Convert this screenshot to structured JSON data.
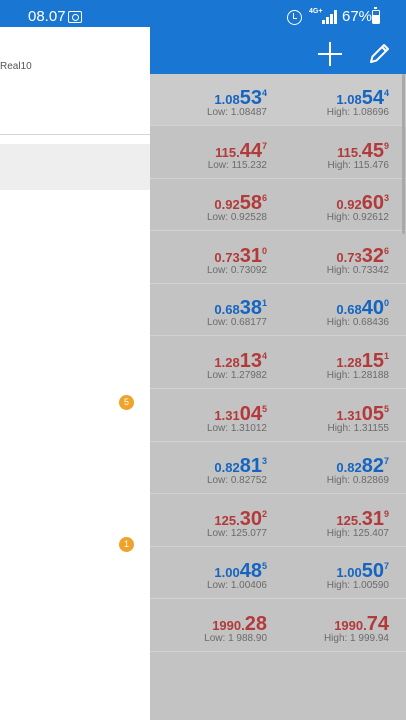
{
  "status_bar": {
    "time": "08.07",
    "network": "4G+",
    "battery_pct": "67%"
  },
  "drawer": {
    "account_label": "Real10",
    "badges": [
      {
        "count": "5"
      },
      {
        "count": "1"
      }
    ]
  },
  "quotes": [
    {
      "bid": {
        "base": "1.08",
        "big": "53",
        "sup": "4"
      },
      "ask": {
        "base": "1.08",
        "big": "54",
        "sup": "4"
      },
      "low": "Low: 1.08487",
      "high": "High: 1.08696",
      "dir": "up"
    },
    {
      "bid": {
        "base": "115.",
        "big": "44",
        "sup": "7"
      },
      "ask": {
        "base": "115.",
        "big": "45",
        "sup": "9"
      },
      "low": "Low: 115.232",
      "high": "High: 115.476",
      "dir": "down"
    },
    {
      "bid": {
        "base": "0.92",
        "big": "58",
        "sup": "6"
      },
      "ask": {
        "base": "0.92",
        "big": "60",
        "sup": "3"
      },
      "low": "Low: 0.92528",
      "high": "High: 0.92612",
      "dir": "down"
    },
    {
      "bid": {
        "base": "0.73",
        "big": "31",
        "sup": "0"
      },
      "ask": {
        "base": "0.73",
        "big": "32",
        "sup": "6"
      },
      "low": "Low: 0.73092",
      "high": "High: 0.73342",
      "dir": "down"
    },
    {
      "bid": {
        "base": "0.68",
        "big": "38",
        "sup": "1"
      },
      "ask": {
        "base": "0.68",
        "big": "40",
        "sup": "0"
      },
      "low": "Low: 0.68177",
      "high": "High: 0.68436",
      "dir": "up"
    },
    {
      "bid": {
        "base": "1.28",
        "big": "13",
        "sup": "4"
      },
      "ask": {
        "base": "1.28",
        "big": "15",
        "sup": "1"
      },
      "low": "Low: 1.27982",
      "high": "High: 1.28188",
      "dir": "down"
    },
    {
      "bid": {
        "base": "1.31",
        "big": "04",
        "sup": "5"
      },
      "ask": {
        "base": "1.31",
        "big": "05",
        "sup": "5"
      },
      "low": "Low: 1.31012",
      "high": "High: 1.31155",
      "dir": "down"
    },
    {
      "bid": {
        "base": "0.82",
        "big": "81",
        "sup": "3"
      },
      "ask": {
        "base": "0.82",
        "big": "82",
        "sup": "7"
      },
      "low": "Low: 0.82752",
      "high": "High: 0.82869",
      "dir": "up"
    },
    {
      "bid": {
        "base": "125.",
        "big": "30",
        "sup": "2"
      },
      "ask": {
        "base": "125.",
        "big": "31",
        "sup": "9"
      },
      "low": "Low: 125.077",
      "high": "High: 125.407",
      "dir": "down"
    },
    {
      "bid": {
        "base": "1.00",
        "big": "48",
        "sup": "5"
      },
      "ask": {
        "base": "1.00",
        "big": "50",
        "sup": "7"
      },
      "low": "Low: 1.00406",
      "high": "High: 1.00590",
      "dir": "up"
    },
    {
      "bid": {
        "base": "1990.",
        "big": "28",
        "sup": ""
      },
      "ask": {
        "base": "1990.",
        "big": "74",
        "sup": ""
      },
      "low": "Low: 1 988.90",
      "high": "High: 1 999.94",
      "dir": "down"
    }
  ],
  "colors": {
    "accent": "#1976d2",
    "up": "#1565c0",
    "down": "#b23a3a",
    "badge": "#f0a32a"
  },
  "icons": {
    "add": "plus-icon",
    "edit": "pencil-icon"
  }
}
